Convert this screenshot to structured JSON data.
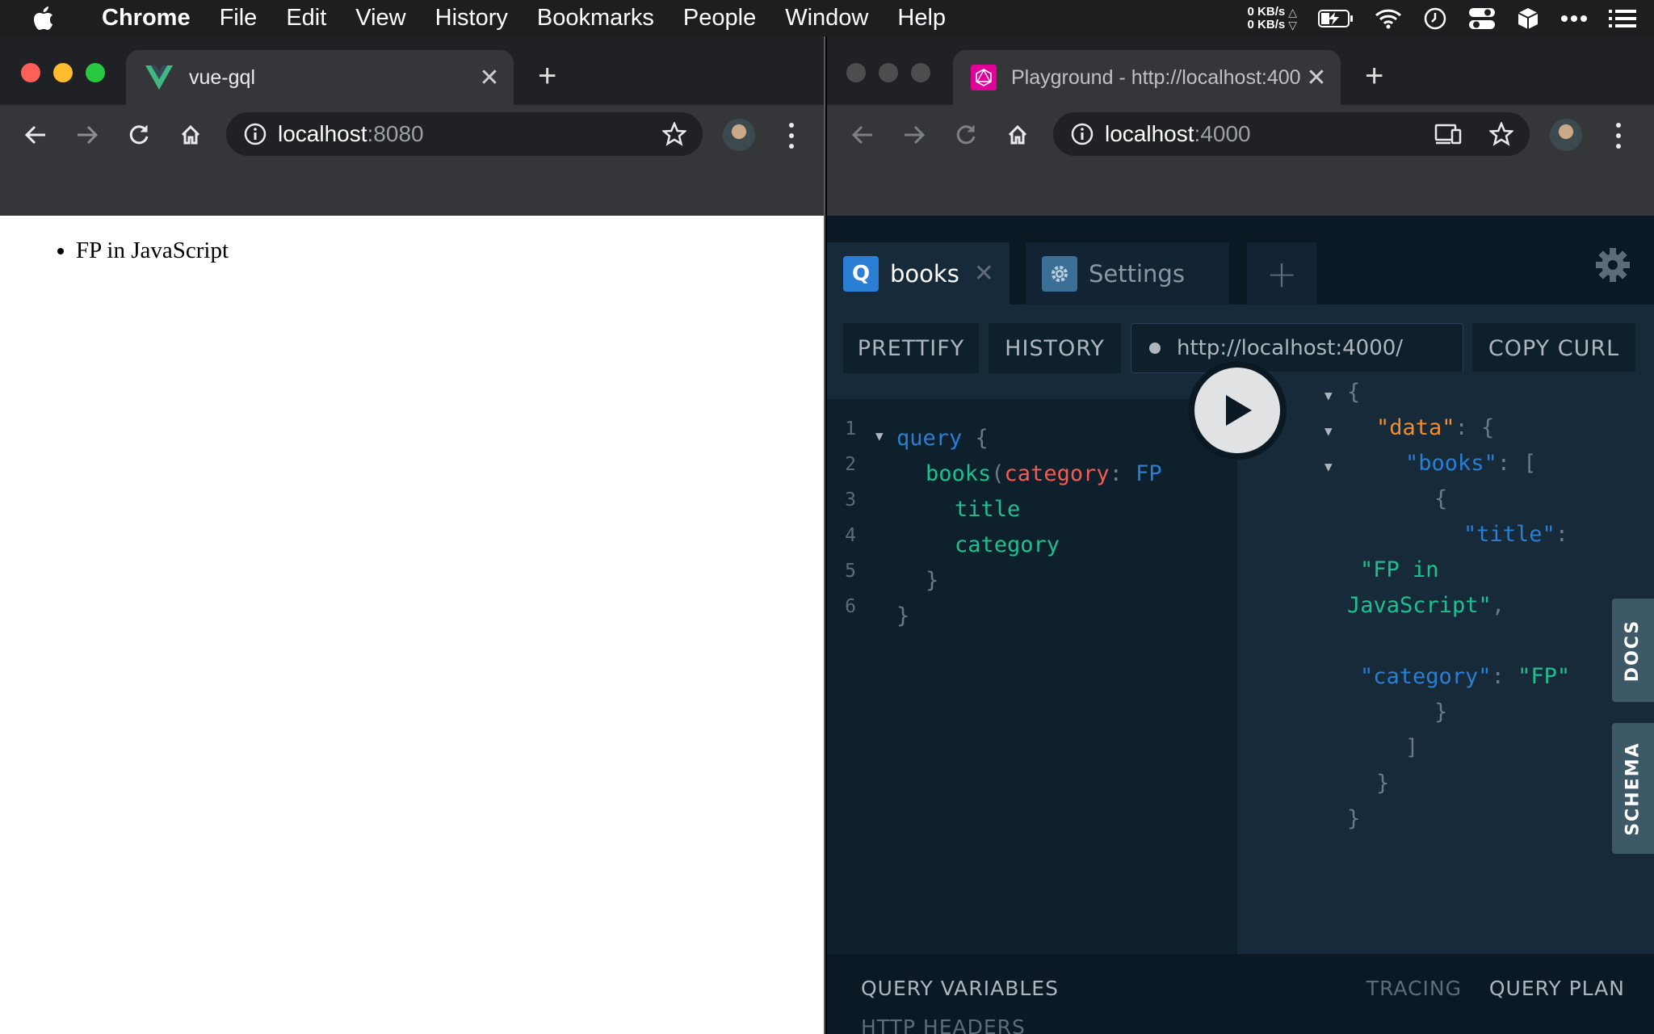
{
  "menubar": {
    "app_name": "Chrome",
    "menus": [
      "File",
      "Edit",
      "View",
      "History",
      "Bookmarks",
      "People",
      "Window",
      "Help"
    ],
    "net_up": "0 KB/s",
    "net_down": "0 KB/s"
  },
  "left_window": {
    "tab_title": "vue-gql",
    "url_host": "localhost",
    "url_port": ":8080",
    "list_items": [
      "FP in JavaScript"
    ]
  },
  "right_window": {
    "tab_title": "Playground - http://localhost:400",
    "url_host": "localhost",
    "url_port": ":4000"
  },
  "playground": {
    "tabs": [
      {
        "badge": "Q",
        "label": "books"
      },
      {
        "label": "Settings"
      }
    ],
    "buttons": {
      "prettify": "PRETTIFY",
      "history": "HISTORY",
      "copy_curl": "COPY CURL"
    },
    "endpoint": "http://localhost:4000/",
    "side_tabs": {
      "docs": "DOCS",
      "schema": "SCHEMA"
    },
    "bottom": {
      "query_variables": "QUERY VARIABLES",
      "http_headers": "HTTP HEADERS",
      "tracing": "TRACING",
      "query_plan": "QUERY PLAN"
    },
    "query_line_numbers": [
      "1",
      "2",
      "3",
      "4",
      "5",
      "6"
    ],
    "query": {
      "l1_kw": "query",
      "l1_brace": " {",
      "l2_field": "books",
      "l2_paren": "(",
      "l2_arg": "category",
      "l2_colon": ": ",
      "l2_enum": "FP",
      "l3_field": "title",
      "l4_field": "category",
      "l5": "}",
      "l6": "}"
    },
    "result": {
      "open": "{",
      "data_key": "\"data\"",
      "colon_open": ": {",
      "books_key": "\"books\"",
      "colon_bracket": ": [",
      "item_open": "{",
      "title_key": "\"title\"",
      "colon": ":",
      "title_val_1": "\"FP in",
      "title_val_2": "JavaScript\"",
      "comma": ",",
      "category_key": "\"category\"",
      "colon_sp": ": ",
      "category_val": "\"FP\"",
      "item_close": "}",
      "arr_close": "]",
      "obj_close": "}",
      "root_close": "}"
    }
  },
  "colors": {
    "graphql_pink": "#e10098",
    "vue_green": "#41b883",
    "playground_bg": "#172a3a",
    "query_badge": "#2a7ed3"
  }
}
